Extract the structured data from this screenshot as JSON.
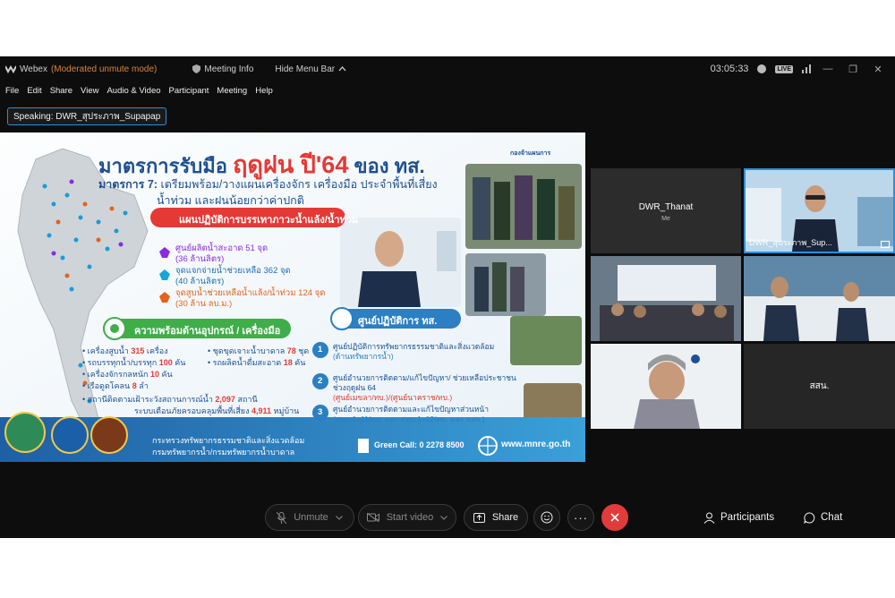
{
  "window": {
    "app_name": "Webex",
    "mode": "(Moderated unmute mode)",
    "meeting_info": "Meeting Info",
    "hide_menu_bar": "Hide Menu Bar",
    "timer": "03:05:33",
    "live_badge": "LIVE"
  },
  "menu": [
    "File",
    "Edit",
    "Share",
    "View",
    "Audio & Video",
    "Participant",
    "Meeting",
    "Help"
  ],
  "speaking": "Speaking: DWR_สุประภาพ_Supapap",
  "slide": {
    "title_prefix": "มาตรการรับมือ",
    "title_highlight": "ฤดูฝน ปี'64",
    "title_suffix": "ของ ทส.",
    "agency_logo": "กองจ้าแผนการ",
    "measure_label": "มาตรการ 7:",
    "measure_text_1": "เตรียมพร้อม/วางแผนเครื่องจักร เครื่องมือ ประจำพื้นที่เสี่ยง",
    "measure_text_2": "น้ำท่วม และฝนน้อยกว่าค่าปกติ",
    "plan_header": "แผนปฏิบัติการบรรเทาภาวะน้ำแล้ง/น้ำท่วม",
    "plan_items": [
      {
        "text": "ศูนย์ผลิตน้ำสะอาด 51 จุด",
        "sub": "(36 ล้านลิตร)",
        "color": "#8a2be2"
      },
      {
        "text": "จุดแจกจ่ายน้ำช่วยเหลือ 362 จุด",
        "sub": "(40 ล้านลิตร)",
        "color": "#16a7d8"
      },
      {
        "text": "จุดสูบน้ำช่วยเหลือน้ำแล้ง/น้ำท่วม 124 จุด",
        "sub": "(30 ล้าน ลบ.ม.)",
        "color": "#e5621c"
      }
    ],
    "equip_header": "ความพร้อมด้านอุปกรณ์ / เครื่องมือ",
    "equip_left": [
      {
        "label": "เครื่องสูบน้ำ",
        "num": "315",
        "unit": "เครื่อง"
      },
      {
        "label": "รถบรรทุกน้ำ/บรรทุก",
        "num": "100",
        "unit": "คัน"
      },
      {
        "label": "เครื่องจักรกลหนัก",
        "num": "10",
        "unit": "คัน"
      },
      {
        "label": "เรือดูดโคลน",
        "num": "8",
        "unit": "ลำ"
      }
    ],
    "equip_right": [
      {
        "label": "ชุดขุดเจาะน้ำบาดาล",
        "num": "78",
        "unit": "ชุด"
      },
      {
        "label": "รถผลิตน้ำดื่มสะอาด",
        "num": "18",
        "unit": "คัน"
      }
    ],
    "station_line": "สถานีติดตามเฝ้าระวังสถานการณ์น้ำ",
    "station_num": "2,097",
    "station_unit": "สถานี",
    "warning_line": "ระบบเตือนภัยครอบคลุมพื้นที่เสี่ยง",
    "warning_num": "4,911",
    "warning_unit": "หมู่บ้าน",
    "center_header": "ศูนย์ปฏิบัติการ ทส.",
    "centers": [
      {
        "num": "1",
        "text": "ศูนย์ปฏิบัติการทรัพยากรธรรมชาติและสิ่งแวดล้อม",
        "sub": "(ด้านทรัพยากรน้ำ)"
      },
      {
        "num": "2",
        "text": "ศูนย์อำนวยการติดตาม/แก้ไขปัญหา/ ช่วยเหลือประชาชน ช่วงฤดูฝน 64",
        "sub": "(ศูนย์เมขลา/ทบ.)/(ศูนย์นาคราช/ทบ.)"
      },
      {
        "num": "3",
        "text": "ศูนย์อำนวยการติดตามและแก้ไขปัญหาส่วนหน้า",
        "sub": "(สทภ.1–11/ทบ. และ สทบ.1–12/ทบ. และ ทสจ.)"
      }
    ],
    "footer_ministry": "กระทรวงทรัพยากรธรรมชาติและสิ่งแวดล้อม",
    "footer_depts": "กรมทรัพยากรน้ำ/กรมทรัพยากรน้ำบาดาล",
    "green_call": "Green Call: 0 2278 8500",
    "website": "www.mnre.go.th"
  },
  "participants": {
    "self_name": "DWR_Thanat",
    "self_label": "Me",
    "speaker_name": "DWR_สุประภาพ_Sup...",
    "other_label": "สสน."
  },
  "controls": {
    "unmute": "Unmute",
    "start_video": "Start video",
    "share": "Share",
    "participants": "Participants",
    "chat": "Chat"
  }
}
